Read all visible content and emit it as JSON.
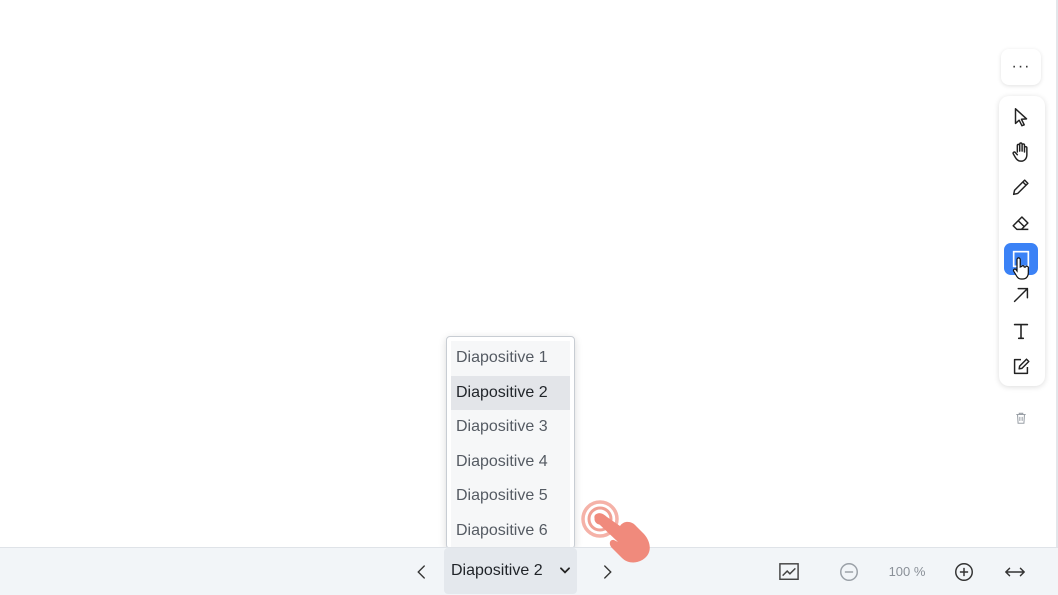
{
  "toolbar": {
    "more_label": "···",
    "tools": [
      {
        "icon": "pointer-icon",
        "active": false
      },
      {
        "icon": "hand-icon",
        "active": false
      },
      {
        "icon": "pencil-icon",
        "active": false
      },
      {
        "icon": "eraser-icon",
        "active": false
      },
      {
        "icon": "rectangle-icon",
        "active": true
      },
      {
        "icon": "arrow-icon",
        "active": false
      },
      {
        "icon": "text-icon",
        "active": false
      },
      {
        "icon": "note-edit-icon",
        "active": false
      }
    ],
    "trash_icon": "trash-icon"
  },
  "dropdown": {
    "options": [
      "Diapositive 1",
      "Diapositive 2",
      "Diapositive 3",
      "Diapositive 4",
      "Diapositive 5",
      "Diapositive 6"
    ],
    "selected_index": 1
  },
  "bottombar": {
    "slide_select_value": "Diapositive 2",
    "zoom_label": "100 %"
  },
  "colors": {
    "accent": "#3b82f6",
    "bar_bg": "#f2f5f8",
    "touch": "#f08a7c"
  }
}
